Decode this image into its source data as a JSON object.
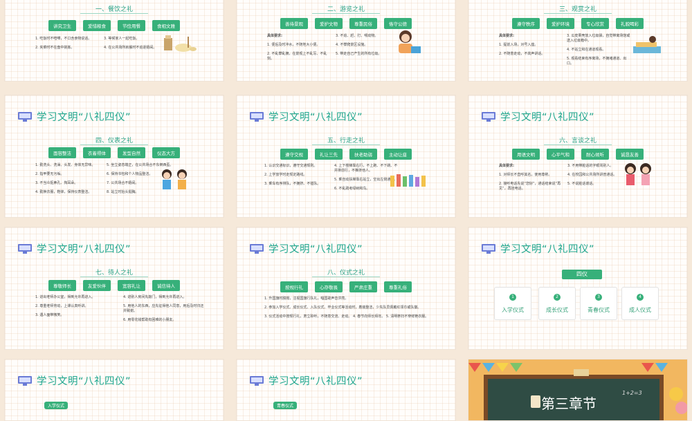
{
  "common_title": "学习文明“八礼四仪”",
  "slides": {
    "dining": {
      "section": "一、餐饮之礼",
      "buttons": [
        "讲究卫生",
        "爱惜粮食",
        "节俭用餐",
        "食相文雅"
      ],
      "left": [
        "1. 吃饭时不喧嘩，不口含食物说话。",
        "2. 夹菜时不在盘中挑拣。"
      ],
      "right": [
        "3. 等候家人一起吃饭。",
        "4. 在公共场所就餐时不追逐嬉闹。"
      ]
    },
    "travel": {
      "section": "二、游览之礼",
      "buttons": [
        "善待景观",
        "爱护文物",
        "尊重民俗",
        "恪守公德"
      ],
      "left_head": "具体要求:",
      "left": [
        "1. 便后及时冲水，不随地大小便。",
        "2. 不乱攀乱摘，在景观上不乱写、不乱刻。"
      ],
      "right": [
        "3. 不追、赶、打、喂动物。",
        "4. 不攀爬景区设施。",
        "5. 带走自己产生的所有垃圾。"
      ]
    },
    "viewing": {
      "section": "三、观赏之礼",
      "buttons": [
        "遵守秩序",
        "爱护环境",
        "专心欣赏",
        "礼貌喝彩"
      ],
      "left_head": "具体要求:",
      "left": [
        "1. 提前入场，对号入座。",
        "2. 不随意走动，不高声讲话。"
      ],
      "right": [
        "3. 瓜皮果壳放入垃圾袋，自觉带离场馆或送入垃圾箱中。",
        "4. 不站立和在通道观看。",
        "5. 观看结束有序离场，不拥堵通道、出口。"
      ]
    },
    "appearance": {
      "section": "四、仪表之礼",
      "buttons": [
        "面容整洁",
        "衣着得体",
        "发型自然",
        "仪态大方"
      ],
      "left": [
        "1. 勤洗头、洗澡、头发、身体无异味。",
        "2. 指甲要无污垢。",
        "3. 不当众抠鼻孔、掏耳朵。",
        "4. 勤换衣服，鞋袜，保持仪表整洁。"
      ],
      "right": [
        "5. 坐立姿态端正，在公共场合不东倒西歪。",
        "6. 保持书包和个人物品整洁。",
        "7. 公共场合不嬉闹。",
        "8. 站立时抬头挺胸。"
      ]
    },
    "walking": {
      "section": "五、行走之礼",
      "buttons": [
        "遵守交规",
        "礼让三先",
        "扶老助弱",
        "主动让座"
      ],
      "left": [
        "1. 认识交通标识，遵守交通规则。",
        "2. 上学放学时走规定路线。",
        "3. 乘车有序排队，不拥挤、不插队。"
      ],
      "right": [
        "4. 上下楼梯靠右行，不上跑、不下跳、不并排前行，不推挤他人。",
        "5. 乘自动扶梯靠右站立，空出左侧通道。",
        "6. 不乱践考绿树和鸟。"
      ]
    },
    "speech": {
      "section": "六、言谈之礼",
      "buttons": [
        "用语文明",
        "心平气和",
        "耐心倾听",
        "诚恳友善"
      ],
      "left_head": "具体要求:",
      "left": [
        "1. 对师长不直呼其名，使用尊称。",
        "2. 接听电话先说“您好”，通话结束说“再见”，再挂电话。"
      ],
      "right": [
        "3. 不用带脏话的字眼骂别人。",
        "4. 在校园和公共场所讲普通话。",
        "5. 不说脏话谎话。"
      ]
    },
    "hospitality": {
      "section": "七、待人之礼",
      "buttons": [
        "尊敬师长",
        "友爱伙伴",
        "宽容礼让",
        "诚信待人"
      ],
      "left": [
        "1. 进出老师办公室，得到允许再进入。",
        "2. 尊重老师劳动，上课认真听讲。",
        "3. 遇人面带微笑。"
      ],
      "right": [
        "4. 进别人房间先敲门，得到允许再进入。",
        "5. 用他人的东西，应先征得他人同意，用后及时归还并致谢。",
        "6. 用零花钱帮助有困难的小朋友。"
      ]
    },
    "ceremony": {
      "section": "八、仪式之礼",
      "buttons": [
        "按规行礼",
        "心存敬畏",
        "严肃庄重",
        "尊重礼俗"
      ],
      "lines": [
        "1. 升国旗时脱帽，注视国旗行队礼，唱国歌声音洪亮。",
        "2. 参加入学仪式、成长仪式、入队仪式、毕业仪式等活动时，着装整洁，少先队员佩戴红领巾或队徽。",
        "3. 仪式活动中按规行礼，肃立聆听，不随意交流、走动。 4. 春节向师长拜年。 5. 清明祭扫不穿鲜艳衣服。"
      ]
    },
    "four_rites": {
      "heading": "四仪",
      "cards": [
        {
          "num": "1",
          "label": "入学仪式"
        },
        {
          "num": "2",
          "label": "成长仪式"
        },
        {
          "num": "3",
          "label": "青春仪式"
        },
        {
          "num": "4",
          "label": "成人仪式"
        }
      ]
    },
    "enrollment": {
      "tag": "入学仪式"
    },
    "youth": {
      "tag": "青春仪式"
    },
    "chapter": {
      "title": "第三章节",
      "scribble": "1+2=3"
    }
  }
}
